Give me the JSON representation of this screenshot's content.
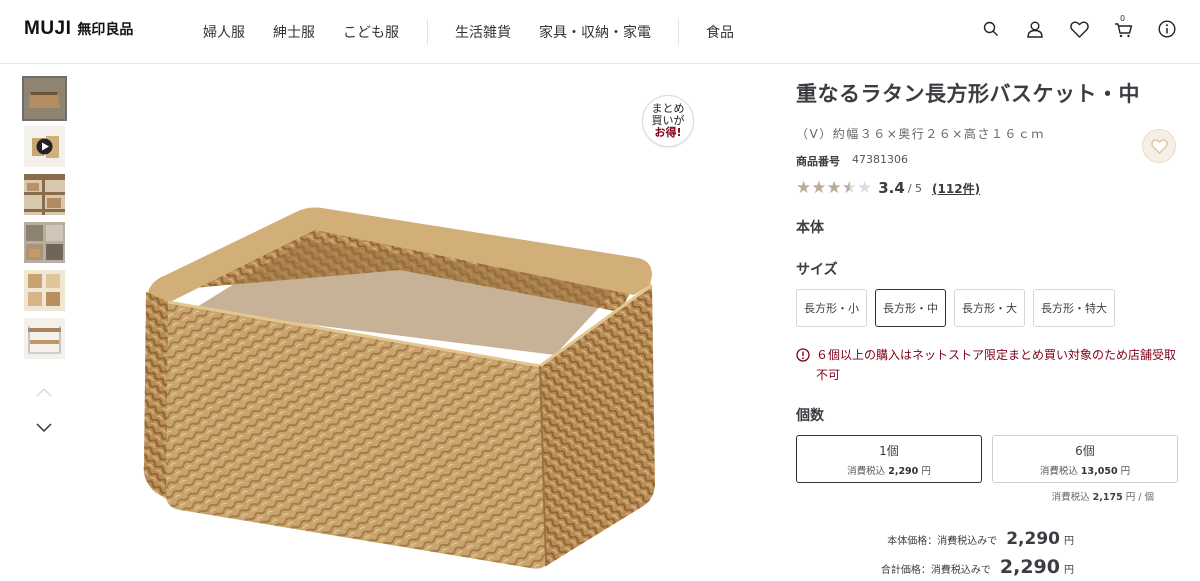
{
  "header": {
    "logo_main": "MUJI",
    "logo_sub": "無印良品",
    "nav": [
      "婦人服",
      "紳士服",
      "こども服",
      "生活雑貨",
      "家具・収納・家電",
      "食品"
    ],
    "cart_count": "0",
    "icons": [
      "search-icon",
      "user-icon",
      "heart-icon",
      "cart-icon",
      "info-icon"
    ]
  },
  "badge": {
    "line1": "まとめ",
    "line2": "買いが",
    "line3": "お得!"
  },
  "product": {
    "title": "重なるラタン長方形バスケット・中",
    "spec": "（V）約幅３６×奥行２６×高さ１６ｃｍ",
    "prodno_label": "商品番号",
    "prodno_value": "47381306",
    "rating": 3.4,
    "rating_text": "3.4",
    "rating_max": "/ 5",
    "review_count": "(112件)",
    "body_label": "本体",
    "size_label": "サイズ",
    "sizes": [
      "長方形・小",
      "長方形・中",
      "長方形・大",
      "長方形・特大"
    ],
    "selected_size": "長方形・中",
    "warning": "６個以上の購入はネットストア限定まとめ買い対象のため店舗受取不可",
    "qty_label": "個数",
    "qty_options": [
      {
        "label": "1個",
        "price_prefix": "消費税込",
        "price": "2,290",
        "price_suffix": "円"
      },
      {
        "label": "6個",
        "price_prefix": "消費税込",
        "price": "13,050",
        "price_suffix": "円"
      }
    ],
    "unit_prefix": "消費税込",
    "unit_price": "2,175",
    "unit_suffix": "円 / 個",
    "body_price_label": "本体価格：消費税込みで",
    "body_price": "2,290",
    "total_price_label": "合計価格：消費税込みで",
    "total_price": "2,290",
    "yen": "円"
  },
  "colors": {
    "warning": "#7f0019",
    "star": "#b9ac94",
    "fav_bg": "#f5efe5"
  }
}
